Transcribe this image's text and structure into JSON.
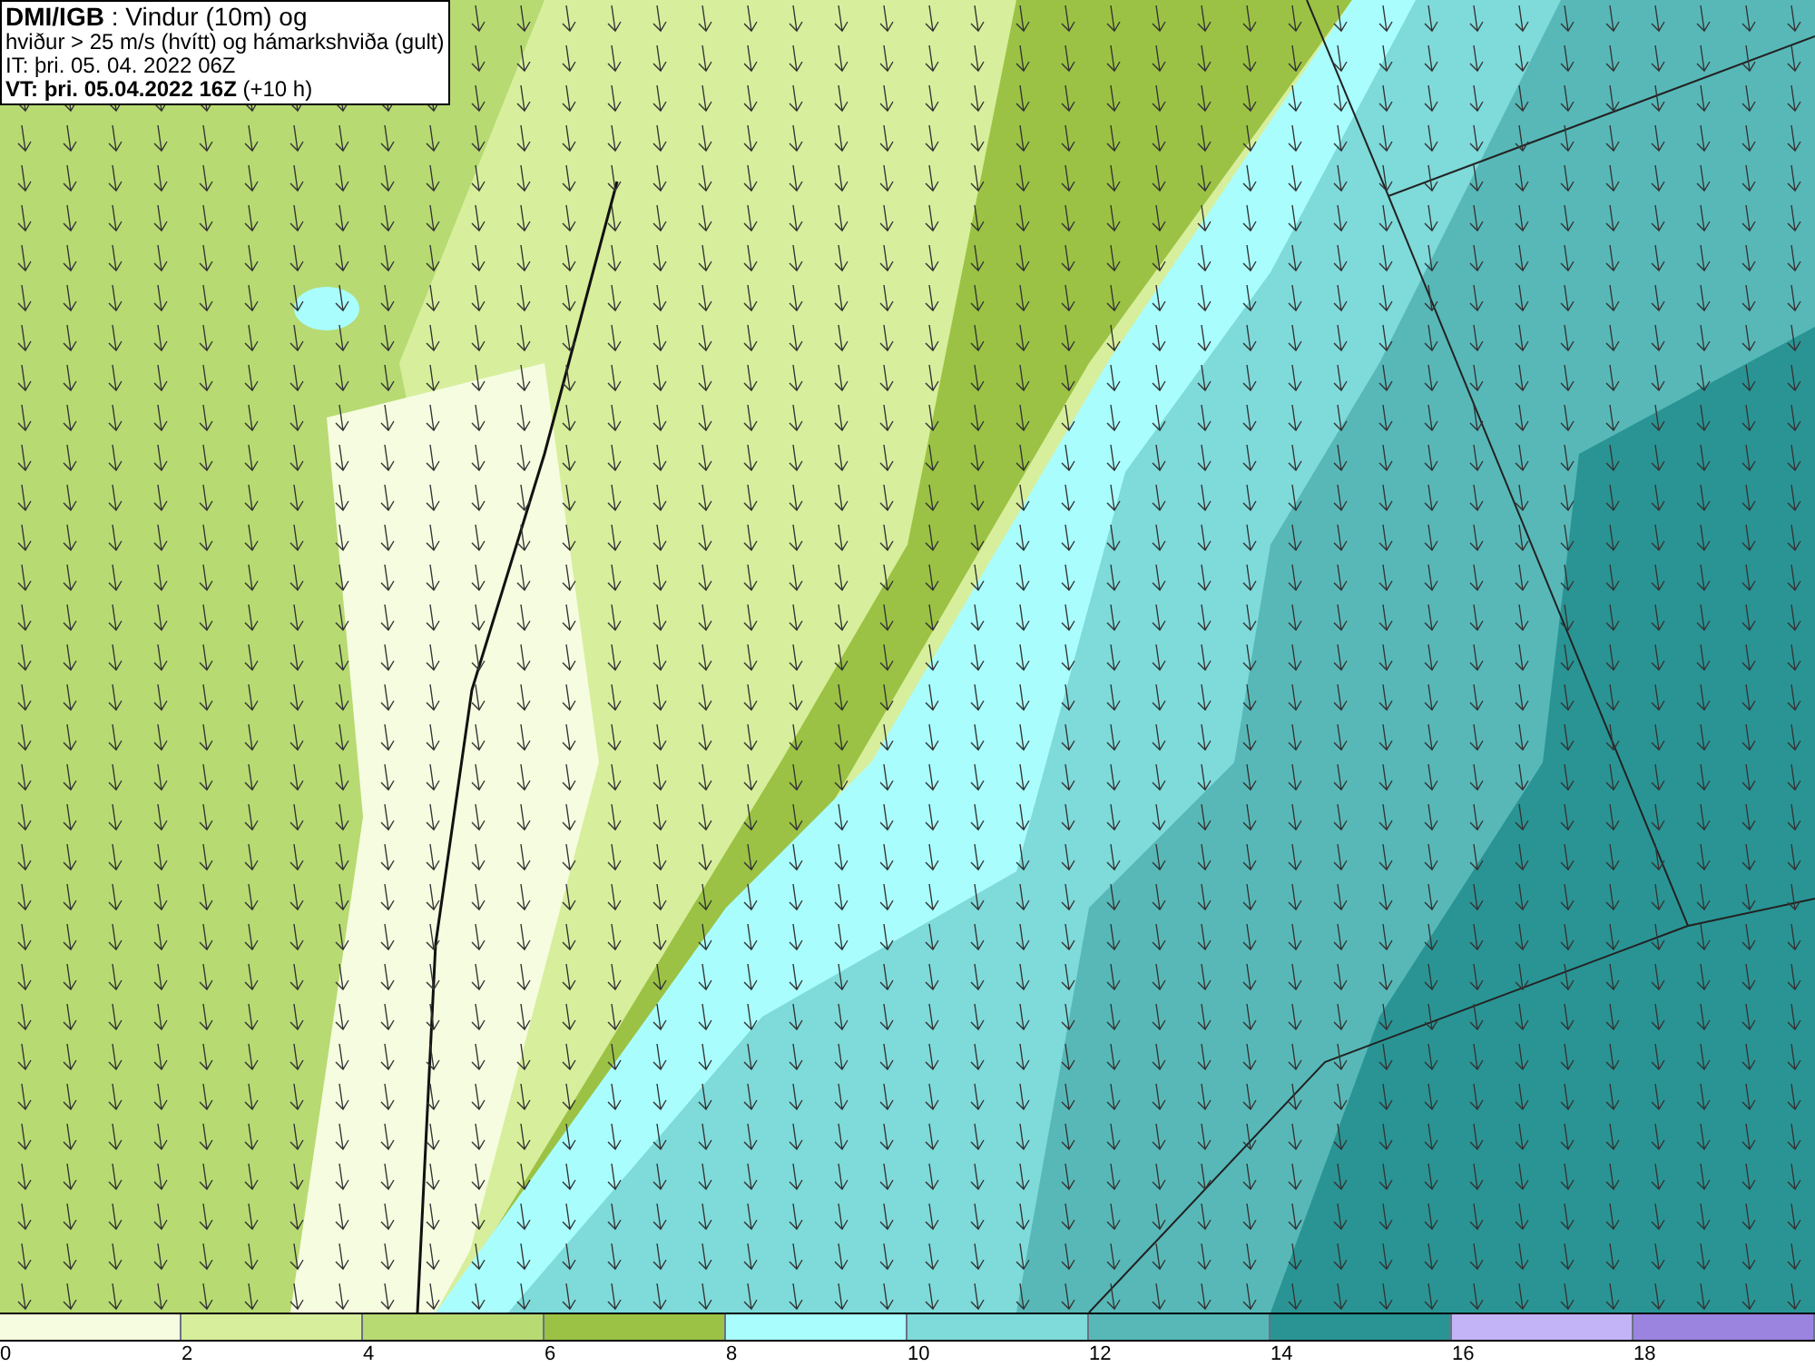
{
  "header": {
    "lines": [
      "**DMI/IGB** : Vindur (10m) og",
      "hviður > 25 m/s (hvítt) og hámarkshviða (gult)",
      "IT: þri. 05. 04. 2022 06Z",
      "**VT: þri. 05.04.2022 16Z** (+10 h)"
    ]
  },
  "legend": [
    {
      "label": "0",
      "color": "#f5fcdf"
    },
    {
      "label": "2",
      "color": "#d7ee9c"
    },
    {
      "label": "4",
      "color": "#b7da72"
    },
    {
      "label": "6",
      "color": "#9bc244"
    },
    {
      "label": "8",
      "color": "#a9fdfd"
    },
    {
      "label": "10",
      "color": "#7fdada"
    },
    {
      "label": "12",
      "color": "#58b8b8"
    },
    {
      "label": "14",
      "color": "#2a9494"
    },
    {
      "label": "16",
      "color": "#c3b4f8"
    },
    {
      "label": "18",
      "color": "#9a84df"
    }
  ]
}
